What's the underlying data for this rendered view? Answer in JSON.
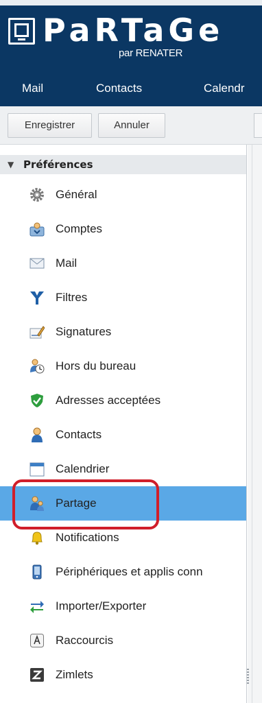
{
  "brand": {
    "logo_word": "PaRTaGe",
    "logo_sub": "par RENATER"
  },
  "nav": {
    "tabs": [
      "Mail",
      "Contacts",
      "Calendr"
    ]
  },
  "toolbar": {
    "save_label": "Enregistrer",
    "cancel_label": "Annuler"
  },
  "sidebar": {
    "section_title": "Préférences",
    "items": [
      {
        "label": "Général",
        "icon": "gear-icon"
      },
      {
        "label": "Comptes",
        "icon": "accounts-icon"
      },
      {
        "label": "Mail",
        "icon": "envelope-icon"
      },
      {
        "label": "Filtres",
        "icon": "filter-icon"
      },
      {
        "label": "Signatures",
        "icon": "signature-icon"
      },
      {
        "label": "Hors du bureau",
        "icon": "out-of-office-icon"
      },
      {
        "label": "Adresses acceptées",
        "icon": "shield-check-icon"
      },
      {
        "label": "Contacts",
        "icon": "contact-icon"
      },
      {
        "label": "Calendrier",
        "icon": "calendar-icon"
      },
      {
        "label": "Partage",
        "icon": "sharing-icon",
        "selected": true
      },
      {
        "label": "Notifications",
        "icon": "bell-icon"
      },
      {
        "label": "Périphériques et applis conn",
        "icon": "mobile-device-icon"
      },
      {
        "label": "Importer/Exporter",
        "icon": "import-export-icon"
      },
      {
        "label": "Raccourcis",
        "icon": "keyboard-icon"
      },
      {
        "label": "Zimlets",
        "icon": "zimlet-icon"
      }
    ]
  },
  "colors": {
    "header_bg": "#0b3763",
    "selected_bg": "#5aa8e6",
    "highlight_ring": "#d01e2a"
  }
}
